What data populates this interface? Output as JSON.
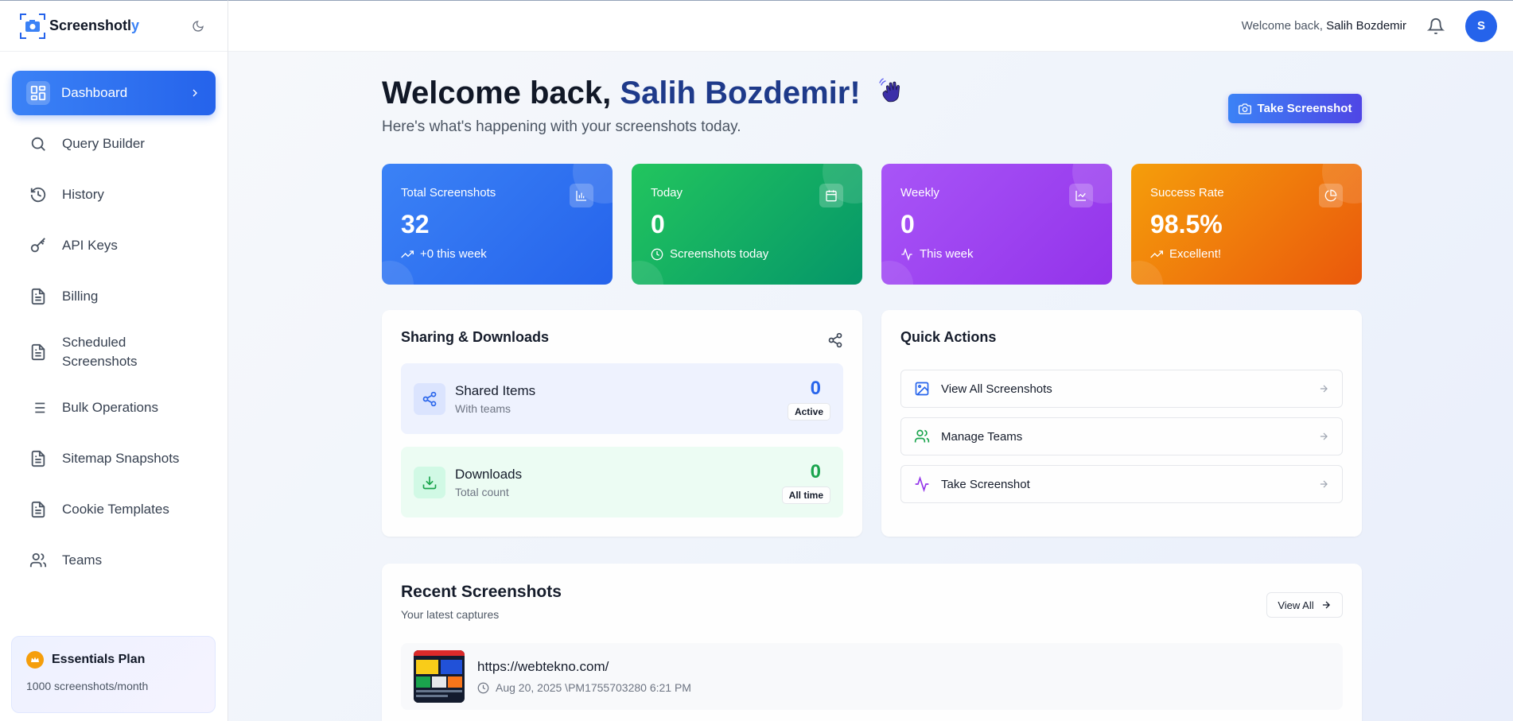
{
  "brand": {
    "name_main": "Screenshotl",
    "name_accent": "y"
  },
  "sidebar": {
    "items": [
      {
        "label": "Dashboard"
      },
      {
        "label": "Query Builder"
      },
      {
        "label": "History"
      },
      {
        "label": "API Keys"
      },
      {
        "label": "Billing"
      },
      {
        "label": "Scheduled Screenshots"
      },
      {
        "label": "Bulk Operations"
      },
      {
        "label": "Sitemap Snapshots"
      },
      {
        "label": "Cookie Templates"
      },
      {
        "label": "Teams"
      }
    ],
    "plan": {
      "title": "Essentials Plan",
      "subtitle": "1000 screenshots/month"
    }
  },
  "header": {
    "welcome_prefix": "Welcome back,",
    "user_name": "Salih Bozdemir",
    "avatar_initial": "S"
  },
  "main": {
    "heading_prefix": "Welcome back,",
    "heading_name": "Salih Bozdemir!",
    "subheading": "Here's what's happening with your screenshots today.",
    "take_screenshot_label": "Take Screenshot",
    "stats": [
      {
        "title": "Total Screenshots",
        "value": "32",
        "foot": "+0 this week",
        "color": "#2563eb"
      },
      {
        "title": "Today",
        "value": "0",
        "foot": "Screenshots today",
        "color": "#16a34a"
      },
      {
        "title": "Weekly",
        "value": "0",
        "foot": "This week",
        "color": "#9333ea"
      },
      {
        "title": "Success Rate",
        "value": "98.5%",
        "foot": "Excellent!",
        "color": "#ea580c"
      }
    ],
    "sharing": {
      "title": "Sharing & Downloads",
      "shared": {
        "title": "Shared Items",
        "sub": "With teams",
        "count": "0",
        "badge": "Active"
      },
      "downloads": {
        "title": "Downloads",
        "sub": "Total count",
        "count": "0",
        "badge": "All time"
      }
    },
    "quick_actions": {
      "title": "Quick Actions",
      "items": [
        {
          "label": "View All Screenshots",
          "icon": "image-icon"
        },
        {
          "label": "Manage Teams",
          "icon": "users-icon"
        },
        {
          "label": "Take Screenshot",
          "icon": "activity-icon"
        }
      ]
    },
    "recent": {
      "title": "Recent Screenshots",
      "subtitle": "Your latest captures",
      "view_all_label": "View All",
      "items": [
        {
          "url": "https://webtekno.com/",
          "meta": "Aug 20, 2025 \\PM1755703280 6:21 PM"
        }
      ]
    }
  }
}
